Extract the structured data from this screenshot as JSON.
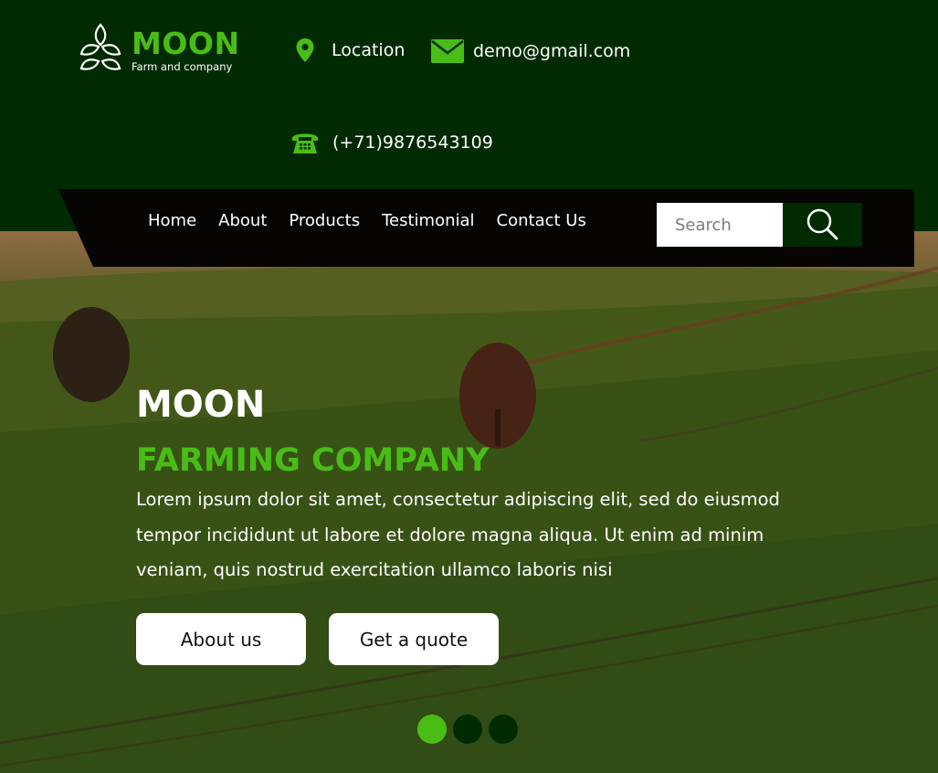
{
  "brand": {
    "title": "MOON",
    "subtitle": "Farm and company",
    "icon": "leaf-logo-icon"
  },
  "contact": {
    "location": {
      "label": "Location",
      "icon": "map-pin-icon"
    },
    "email": {
      "label": "demo@gmail.com",
      "icon": "envelope-icon"
    },
    "phone": {
      "label": "(+71)9876543109",
      "icon": "telephone-icon"
    }
  },
  "nav": {
    "items": [
      {
        "label": "Home"
      },
      {
        "label": "About"
      },
      {
        "label": "Products"
      },
      {
        "label": "Testimonial"
      },
      {
        "label": "Contact Us"
      }
    ],
    "search": {
      "placeholder": "Search",
      "value": "",
      "icon": "search-icon"
    }
  },
  "hero": {
    "title": "MOON",
    "subtitle": "FARMING COMPANY",
    "text": "Lorem ipsum dolor sit amet, consectetur adipiscing elit, sed do eiusmod tempor incididunt ut labore et dolore magna aliqua. Ut enim ad minim veniam, quis nostrud exercitation ullamco laboris nisi",
    "buttons": {
      "about": "About us",
      "quote": "Get a quote"
    },
    "carousel": {
      "slides": 3,
      "active": 1
    }
  },
  "colors": {
    "dark_green": "#002a00",
    "accent_green": "#49bd16",
    "navbar": "#060503",
    "white": "#ffffff"
  }
}
